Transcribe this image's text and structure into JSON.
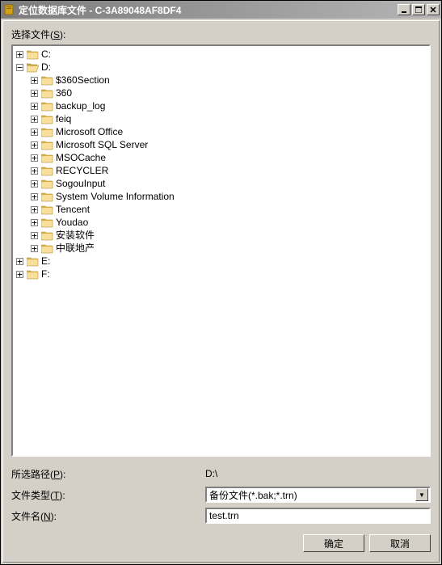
{
  "window": {
    "title": "定位数据库文件 - C-3A89048AF8DF4"
  },
  "labels": {
    "select_files": "选择文件(S):",
    "selected_path": "所选路径(P):",
    "file_type": "文件类型(T):",
    "file_name": "文件名(N):"
  },
  "tree": {
    "drives": [
      {
        "label": "C:",
        "expanded": false,
        "children": []
      },
      {
        "label": "D:",
        "expanded": true,
        "children": [
          {
            "label": "$360Section"
          },
          {
            "label": "360"
          },
          {
            "label": "backup_log"
          },
          {
            "label": "feiq"
          },
          {
            "label": "Microsoft Office"
          },
          {
            "label": "Microsoft SQL Server"
          },
          {
            "label": "MSOCache"
          },
          {
            "label": "RECYCLER"
          },
          {
            "label": "SogouInput"
          },
          {
            "label": "System Volume Information"
          },
          {
            "label": "Tencent"
          },
          {
            "label": "Youdao"
          },
          {
            "label": "安装软件"
          },
          {
            "label": "中联地产"
          }
        ]
      },
      {
        "label": "E:",
        "expanded": false,
        "children": []
      },
      {
        "label": "F:",
        "expanded": false,
        "children": []
      }
    ]
  },
  "form": {
    "selected_path_value": "D:\\",
    "file_type_value": "备份文件(*.bak;*.trn)",
    "file_name_value": "test.trn"
  },
  "buttons": {
    "ok": "确定",
    "cancel": "取消"
  },
  "expand": {
    "plus": "+",
    "minus": "−"
  },
  "select_arrow": "▼"
}
